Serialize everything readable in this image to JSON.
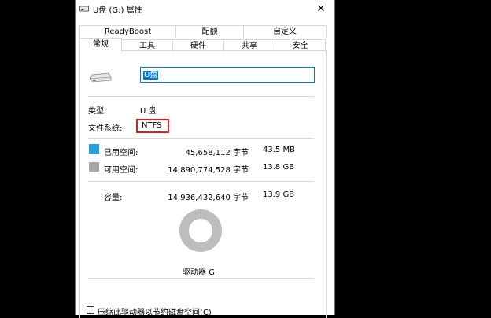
{
  "window": {
    "title": "U盘 (G:) 属性",
    "close_glyph": "✕"
  },
  "tabs_top": [
    {
      "label": "ReadyBoost"
    },
    {
      "label": "配额"
    },
    {
      "label": "自定义"
    }
  ],
  "tabs_bottom": [
    {
      "label": "常规",
      "active": true
    },
    {
      "label": "工具"
    },
    {
      "label": "硬件"
    },
    {
      "label": "共享"
    },
    {
      "label": "安全"
    }
  ],
  "general": {
    "drive_name_value": "U盘",
    "type_label": "类型:",
    "type_value": "U 盘",
    "fs_label": "文件系统:",
    "fs_value": "NTFS",
    "used": {
      "label": "已用空间:",
      "bytes": "45,658,112 字节",
      "size": "43.5 MB",
      "color": "#26a0da"
    },
    "free": {
      "label": "可用空间:",
      "bytes": "14,890,774,528 字节",
      "size": "13.8 GB",
      "color": "#a6a6a6"
    },
    "capacity": {
      "label": "容量:",
      "bytes": "14,936,432,640 字节",
      "size": "13.9 GB"
    },
    "used_fraction": 0.003,
    "drive_label": "驱动器 G:",
    "compress_label": "压缩此驱动器以节约磁盘空间(C)"
  },
  "colors": {
    "highlight": "#e0201a",
    "accent": "#0078d7"
  }
}
